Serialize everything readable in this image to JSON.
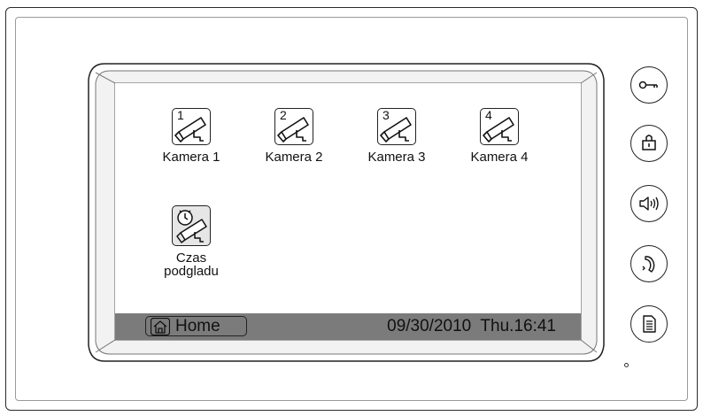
{
  "screen": {
    "tiles": [
      {
        "number": "1",
        "label": "Kamera 1",
        "icon": "camera-icon"
      },
      {
        "number": "2",
        "label": "Kamera 2",
        "icon": "camera-icon"
      },
      {
        "number": "3",
        "label": "Kamera 3",
        "icon": "camera-icon"
      },
      {
        "number": "4",
        "label": "Kamera 4",
        "icon": "camera-icon"
      },
      {
        "label_line1": "Czas",
        "label_line2": "podgladu",
        "icon": "camera-clock-icon"
      }
    ]
  },
  "statusbar": {
    "home_label": "Home",
    "datetime": "09/30/2010  Thu.16:41",
    "background_color": "#7b7b7b"
  },
  "side_buttons": [
    {
      "icon": "key-icon"
    },
    {
      "icon": "unlock-icon"
    },
    {
      "icon": "speaker-icon"
    },
    {
      "icon": "handset-icon"
    },
    {
      "icon": "memo-icon"
    }
  ]
}
